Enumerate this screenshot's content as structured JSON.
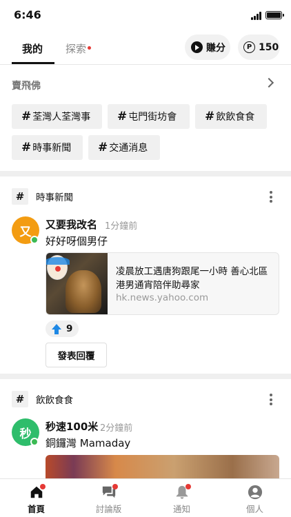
{
  "status_bar": {
    "time": "6:46"
  },
  "top_bar": {
    "tabs": [
      {
        "label": "我的",
        "active": true
      },
      {
        "label": "探索",
        "active": false,
        "has_dot": true
      }
    ],
    "earn_label": "賺分",
    "points_icon": "P",
    "points_value": "150"
  },
  "featured": {
    "title": "賣飛佛",
    "tags": [
      {
        "hash": "#",
        "label": "荃灣人荃灣事"
      },
      {
        "hash": "#",
        "label": "屯門街坊會"
      },
      {
        "hash": "#",
        "label": "飲飲食食"
      },
      {
        "hash": "#",
        "label": "時事新聞"
      },
      {
        "hash": "#",
        "label": "交通消息"
      }
    ]
  },
  "posts": [
    {
      "group_hash": "#",
      "group": "時事新聞",
      "avatar_letter": "又",
      "avatar_color": "#f39c12",
      "author": "又要我改名",
      "time": "1分鐘前",
      "body": "好好呀個男仔",
      "link": {
        "title": "凌晨放工遇唐狗跟尾一小時 善心北區港男通宵陪伴助尋家",
        "source": "hk.news.yahoo.com"
      },
      "votes": "9",
      "reply_label": "發表回覆"
    },
    {
      "group_hash": "#",
      "group": "飲飲食食",
      "avatar_letter": "秒",
      "avatar_color": "#2ebd6b",
      "author": "秒速100米",
      "time": "2分鐘前",
      "body": "銅鑼灣 Mamaday"
    }
  ],
  "bottom_nav": [
    {
      "label": "首頁",
      "icon": "home-icon",
      "active": true,
      "badge": true
    },
    {
      "label": "討論版",
      "icon": "chat-icon",
      "active": false,
      "badge": true
    },
    {
      "label": "通知",
      "icon": "bell-icon",
      "active": false,
      "badge": true
    },
    {
      "label": "個人",
      "icon": "user-icon",
      "active": false,
      "badge": false
    }
  ],
  "colors": {
    "accent_red": "#e53935",
    "upvote_blue": "#1e88e5",
    "online_green": "#3cba54"
  }
}
